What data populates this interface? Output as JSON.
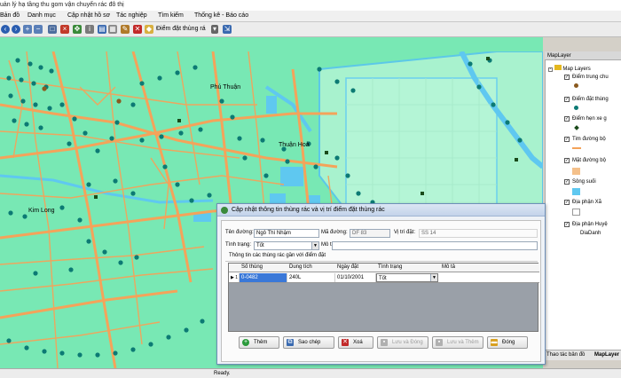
{
  "window": {
    "title": "uản lý hạ tầng thu gom vận chuyển rác đô thị"
  },
  "menu": {
    "items": [
      "Bản đồ",
      "Danh mục",
      "Cập nhật hồ sơ",
      "Tác nghiệp",
      "Tìm kiếm",
      "Thống kê - Báo cáo"
    ]
  },
  "toolbar": {
    "tool_select": "Điểm đặt thùng rá"
  },
  "map": {
    "place_labels": [
      "Phú Thuận",
      "Thuận Hoà",
      "Kim Long"
    ],
    "colors": {
      "land": "#78e8b4",
      "roads": "#f4a35a",
      "water": "#5fc8f0",
      "points": "#0c7a74",
      "special_points": "#1a4a1a"
    }
  },
  "maplayer": {
    "header": "MapLayer",
    "root": "Map Layers",
    "layers": [
      {
        "label": "Điểm trung chu",
        "checked": true,
        "symbol": "circle",
        "color": "#8a5a1e"
      },
      {
        "label": "Điểm đặt thùng",
        "checked": true,
        "symbol": "circle",
        "color": "#0c7a74"
      },
      {
        "label": "Điểm hẹn xe g",
        "checked": true,
        "symbol": "diamond",
        "color": "#1a4a1a"
      },
      {
        "label": "Tim đường bộ",
        "checked": true,
        "symbol": "line",
        "color": "#f4a35a"
      },
      {
        "label": "Mặt đường bộ",
        "checked": true,
        "symbol": "square",
        "color": "#f4c08a"
      },
      {
        "label": "Sông suối",
        "checked": true,
        "symbol": "square",
        "color": "#5fc8f0"
      },
      {
        "label": "Địa phận Xã",
        "checked": true,
        "symbol": "square",
        "color": "#ffffff"
      },
      {
        "label": "Địa phận Huyệ",
        "checked": true,
        "symbol": "none",
        "color": ""
      },
      {
        "label": "DiaDanh",
        "checked": false,
        "symbol": "none",
        "color": ""
      }
    ],
    "bottom_tabs": [
      "Thao tác bản đồ",
      "MapLayer"
    ]
  },
  "status": {
    "text": "Ready."
  },
  "dialog": {
    "title": "Cập nhật thông tin thùng rác và vị trí điểm đặt thùng rác",
    "fields": {
      "street_label": "Tên đường:",
      "street_value": "Ngô Thì Nhậm",
      "code_label": "Mã đường:",
      "code_value": "DF 83",
      "position_label": "Vị trí đặt:",
      "position_value": "SS 14",
      "status_label": "Tình trạng:",
      "status_value": "Tốt",
      "desc_label": "Mô tả:",
      "desc_value": ""
    },
    "group_title": "Thông tin các thùng rác gần với điểm đặt",
    "grid": {
      "columns": [
        "Số thùng",
        "Dung tích",
        "Ngày đặt",
        "Tình trạng",
        "Mô tả"
      ],
      "rows": [
        {
          "index": "1",
          "code": "0-0482",
          "capacity": "240L",
          "date": "01/10/2001",
          "status": "Tốt",
          "desc": ""
        }
      ]
    },
    "buttons": {
      "add": "Thêm",
      "copy": "Sao chép",
      "delete": "Xoá",
      "save_close": "Lưu và Đóng",
      "save_add": "Lưu và Thêm",
      "close": "Đóng"
    }
  }
}
